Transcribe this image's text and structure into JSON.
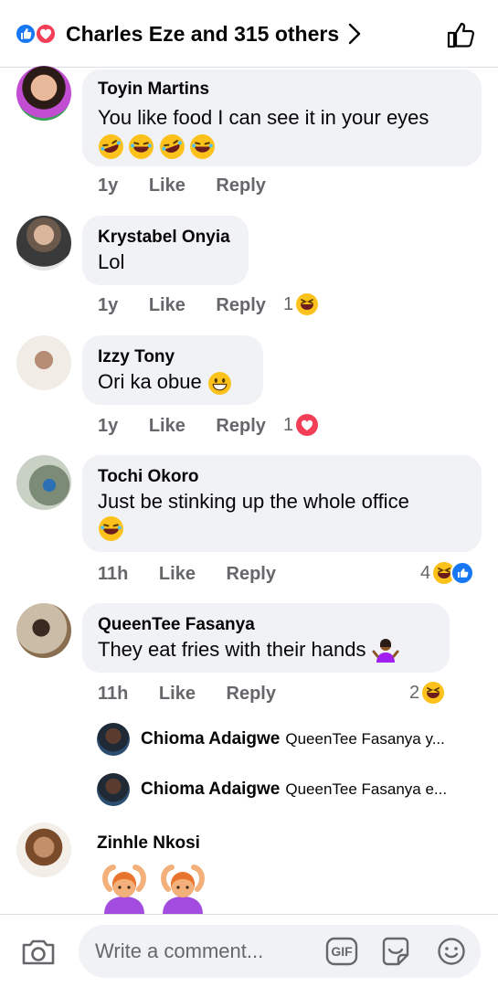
{
  "header": {
    "title": "Charles Eze and 315 others"
  },
  "comments": [
    {
      "author": "Toyin Martins",
      "text": "You like food I can see it in your eyes",
      "time": "1y",
      "like": "Like",
      "reply": "Reply",
      "reaction_count": ""
    },
    {
      "author": "Krystabel Onyia",
      "text": "Lol",
      "time": "1y",
      "like": "Like",
      "reply": "Reply",
      "reaction_count": "1"
    },
    {
      "author": "Izzy Tony",
      "text": "Ori ka obue",
      "time": "1y",
      "like": "Like",
      "reply": "Reply",
      "reaction_count": "1"
    },
    {
      "author": "Tochi Okoro",
      "text": "Just be stinking up the whole office",
      "time": "11h",
      "like": "Like",
      "reply": "Reply",
      "reaction_count": "4"
    },
    {
      "author": "QueenTee Fasanya",
      "text": "They eat fries with their hands",
      "time": "11h",
      "like": "Like",
      "reply": "Reply",
      "reaction_count": "2"
    },
    {
      "author": "Zinhle Nkosi"
    }
  ],
  "replies": [
    {
      "author": "Chioma Adaigwe",
      "text": "QueenTee Fasanya y..."
    },
    {
      "author": "Chioma Adaigwe",
      "text": "QueenTee Fasanya e..."
    }
  ],
  "composer": {
    "placeholder": "Write a comment...",
    "gif_label": "GIF"
  },
  "colors": {
    "facebook_blue": "#1877f2",
    "love_red": "#f33e58",
    "bubble_bg": "#f0f2f5",
    "meta_gray": "#65676b"
  }
}
